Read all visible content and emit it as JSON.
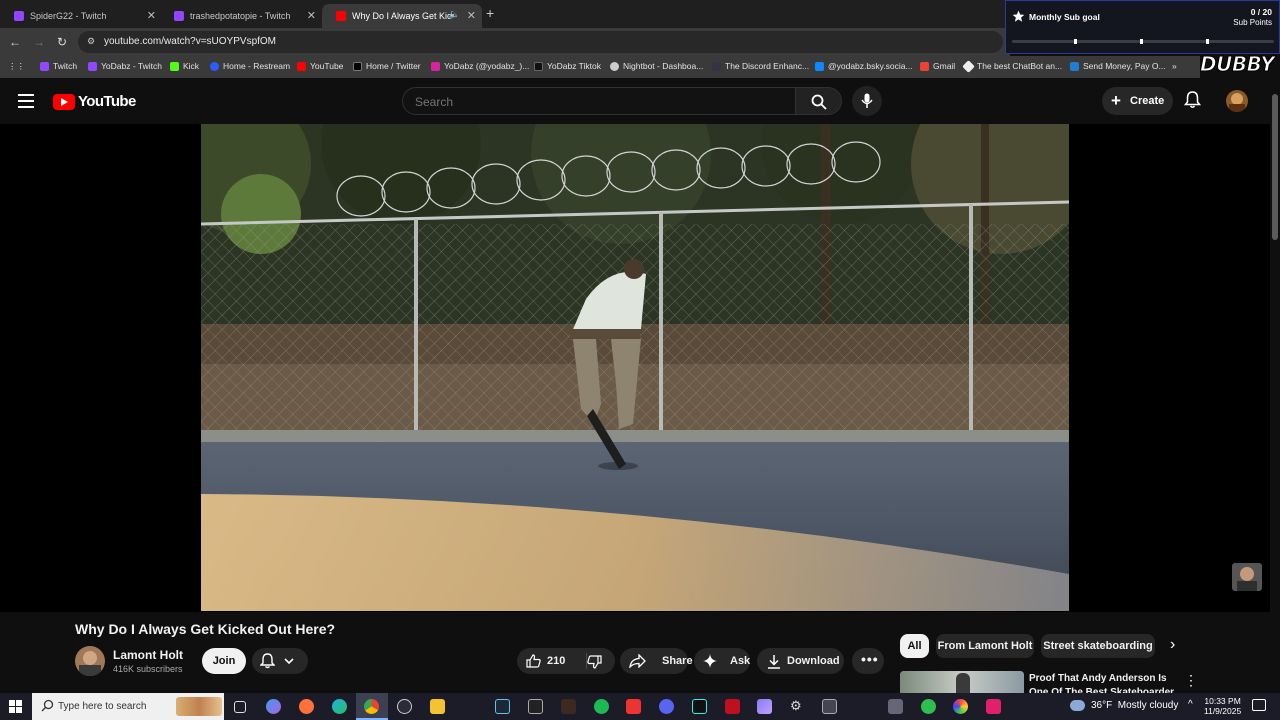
{
  "browser": {
    "tabs": [
      {
        "title": "SpiderG22 - Twitch",
        "active": false
      },
      {
        "title": "trashedpotatopie - Twitch",
        "active": false
      },
      {
        "title": "Why Do I Always Get Kicke",
        "active": true
      }
    ],
    "url": "youtube.com/watch?v=sUOYPVspfOM",
    "bookmarks": [
      "Twitch",
      "YoDabz - Twitch",
      "Kick",
      "Home - Restream",
      "YouTube",
      "Home / Twitter",
      "YoDabz (@yodabz_)...",
      "YoDabz Tiktok",
      "Nightbot - Dashboa...",
      "The Discord Enhanc...",
      "@yodabz.bsky.socia...",
      "Gmail",
      "The best ChatBot an...",
      "Send Money, Pay O..."
    ]
  },
  "overlay": {
    "goal_title": "Monthly Sub goal",
    "goal_count": "0 / 20",
    "goal_unit": "Sub Points",
    "goal_progress": 0,
    "brand": "DUBBY"
  },
  "youtube": {
    "logo_text": "YouTube",
    "search_placeholder": "Search",
    "create_label": "Create"
  },
  "video": {
    "title": "Why Do I Always Get Kicked Out Here?",
    "channel_name": "Lamont Holt",
    "subscribers": "416K subscribers",
    "join_label": "Join",
    "likes": "210",
    "share_label": "Share",
    "ask_label": "Ask",
    "download_label": "Download"
  },
  "recommendations": {
    "chips": [
      "All",
      "From Lamont Holt",
      "Street skateboarding"
    ],
    "first_title": "Proof That Andy Anderson Is One Of The Best Skateboarder"
  },
  "taskbar": {
    "search_placeholder": "Type here to search",
    "weather": "36°F  Mostly cloudy",
    "time": "10:33 PM",
    "date": "11/9/2025"
  },
  "colors": {
    "yt_red": "#ff0000",
    "goal_border": "#2a3a9a",
    "bg": "#0f0f0f"
  }
}
